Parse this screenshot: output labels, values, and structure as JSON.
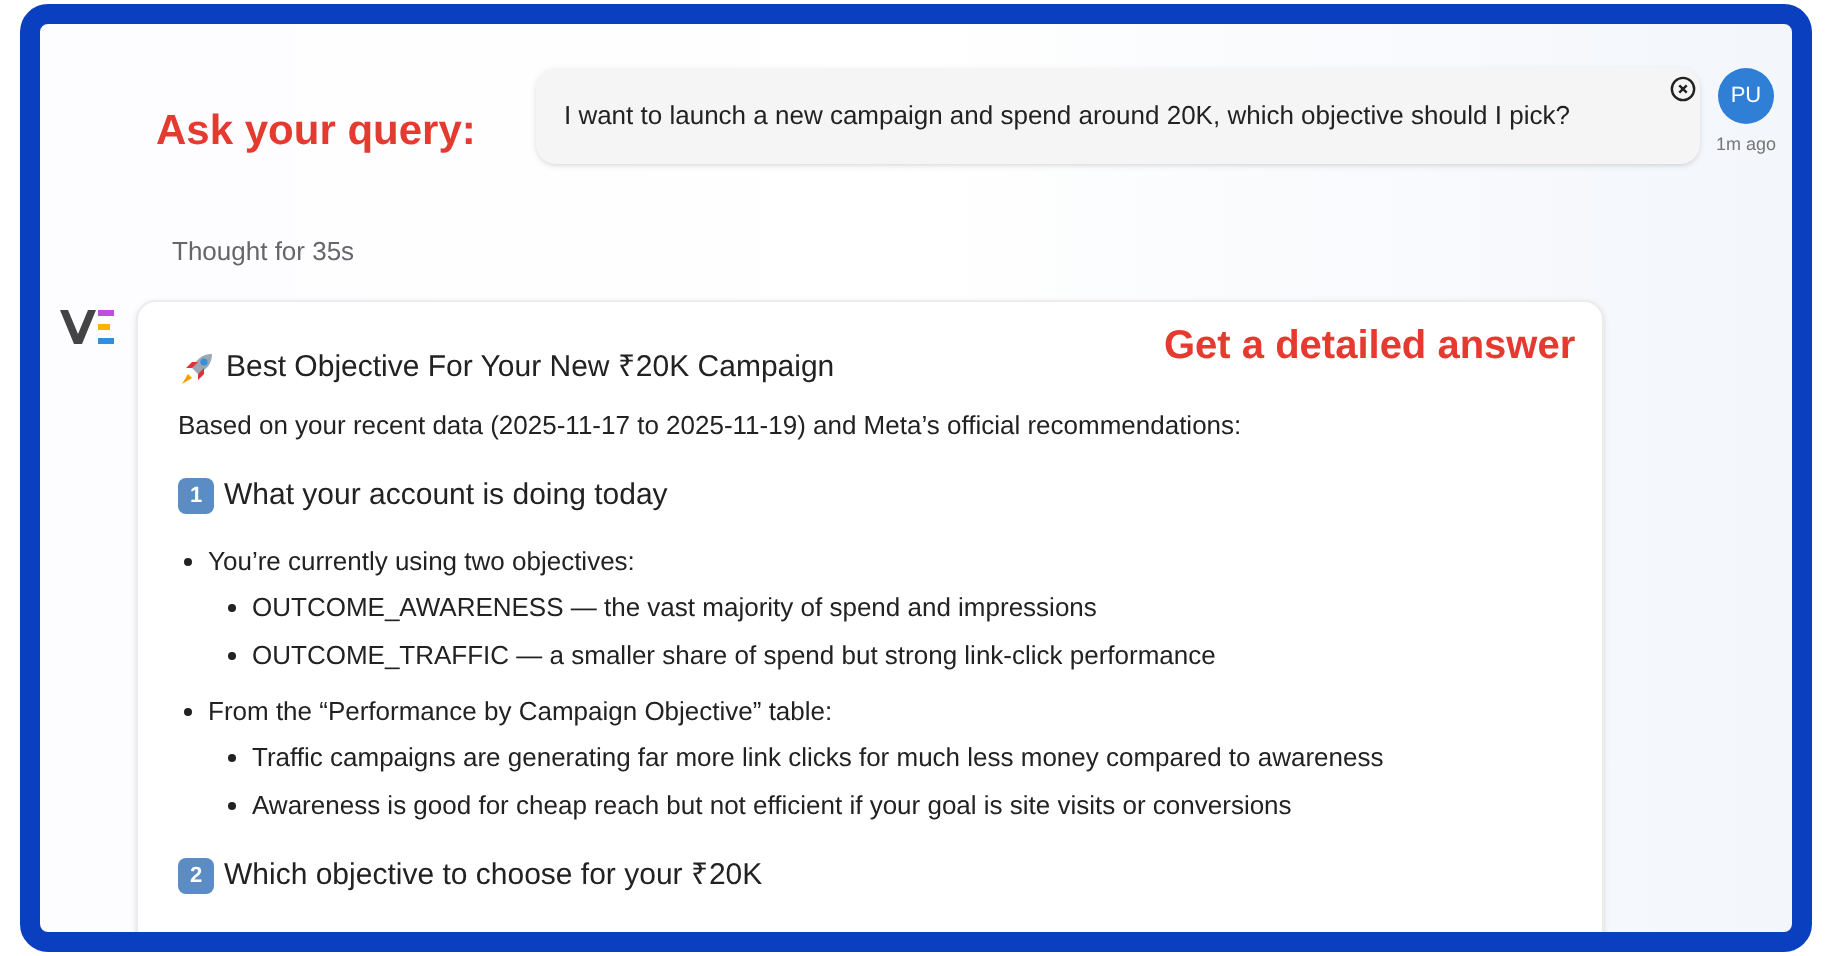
{
  "annotations": [
    {
      "kind": "query",
      "text": "Ask your query:"
    },
    {
      "kind": "answer",
      "text": "Get a detailed answer"
    }
  ],
  "query": {
    "text": "I want to launch a new campaign and spend around 20K, which objective should I pick?",
    "avatar": "PU",
    "time": "1m ago"
  },
  "thought": "Thought for 35s",
  "answer": {
    "title": "Best Objective For Your New ₹20K Campaign",
    "intro": "Based on your recent data (2025-11-17 to 2025-11-19) and Meta’s official recommendations:",
    "sections": [
      {
        "number": "1",
        "heading": "What your account is doing today",
        "items": [
          {
            "text": "You’re currently using two objectives:",
            "children": [
              {
                "text": "OUTCOME_AWARENESS — the vast majority of spend and impressions"
              },
              {
                "text": "OUTCOME_TRAFFIC — a smaller share of spend but strong link-click performance"
              }
            ]
          },
          {
            "text": "From the “Performance by Campaign Objective” table:",
            "children": [
              {
                "text": "Traffic campaigns are generating far more link clicks for much less money compared to awareness"
              },
              {
                "text": "Awareness is good for cheap reach but not efficient if your goal is site visits or conversions"
              }
            ]
          }
        ]
      },
      {
        "number": "2",
        "heading": "Which objective to choose for your ₹20K"
      }
    ]
  }
}
